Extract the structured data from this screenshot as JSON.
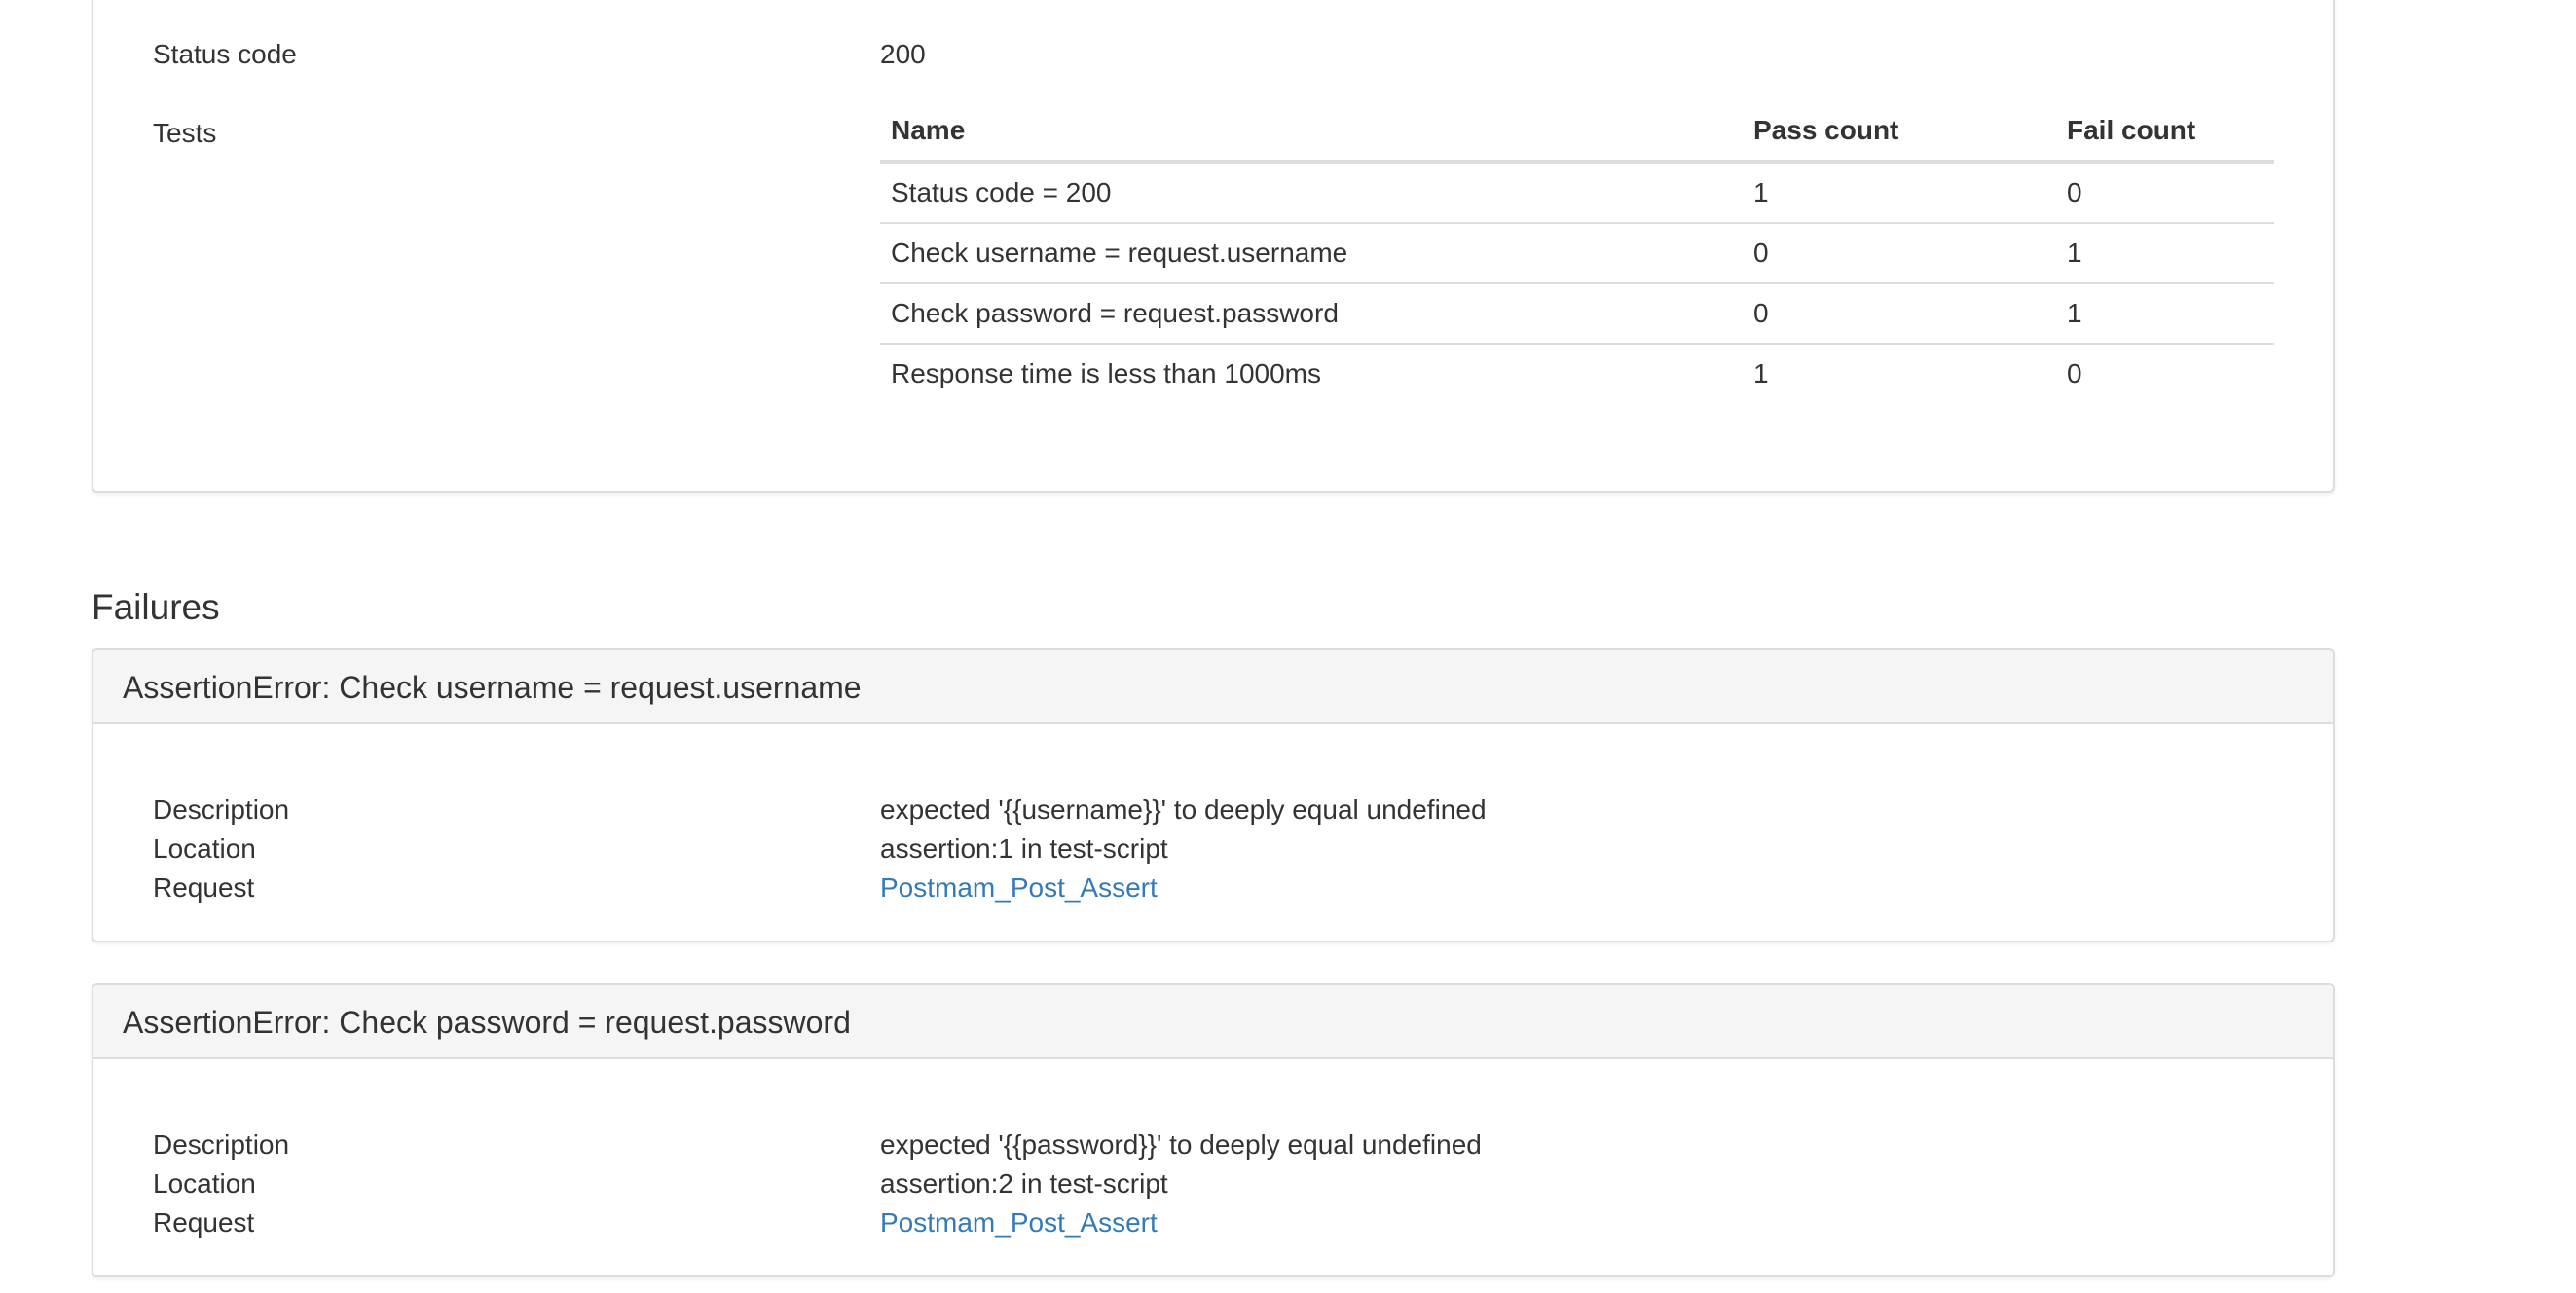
{
  "summary": {
    "status_code_label": "Status code",
    "status_code_value": "200",
    "tests_label": "Tests",
    "table": {
      "headers": [
        "Name",
        "Pass count",
        "Fail count"
      ],
      "rows": [
        {
          "name": "Status code = 200",
          "pass": "1",
          "fail": "0"
        },
        {
          "name": "Check username = request.username",
          "pass": "0",
          "fail": "1"
        },
        {
          "name": "Check password = request.password",
          "pass": "0",
          "fail": "1"
        },
        {
          "name": "Response time is less than 1000ms",
          "pass": "1",
          "fail": "0"
        }
      ]
    }
  },
  "failures": {
    "title": "Failures",
    "items": [
      {
        "heading": "AssertionError: Check username = request.username",
        "description_label": "Description",
        "description_value": "expected '{{username}}' to deeply equal undefined",
        "location_label": "Location",
        "location_value": "assertion:1 in test-script",
        "request_label": "Request",
        "request_value": "Postmam_Post_Assert"
      },
      {
        "heading": "AssertionError: Check password = request.password",
        "description_label": "Description",
        "description_value": "expected '{{password}}' to deeply equal undefined",
        "location_label": "Location",
        "location_value": "assertion:2 in test-script",
        "request_label": "Request",
        "request_value": "Postmam_Post_Assert"
      }
    ]
  },
  "colors": {
    "link": "#337ab7",
    "text": "#333333",
    "border": "#dddddd",
    "panel_heading_bg": "#f5f5f5"
  }
}
